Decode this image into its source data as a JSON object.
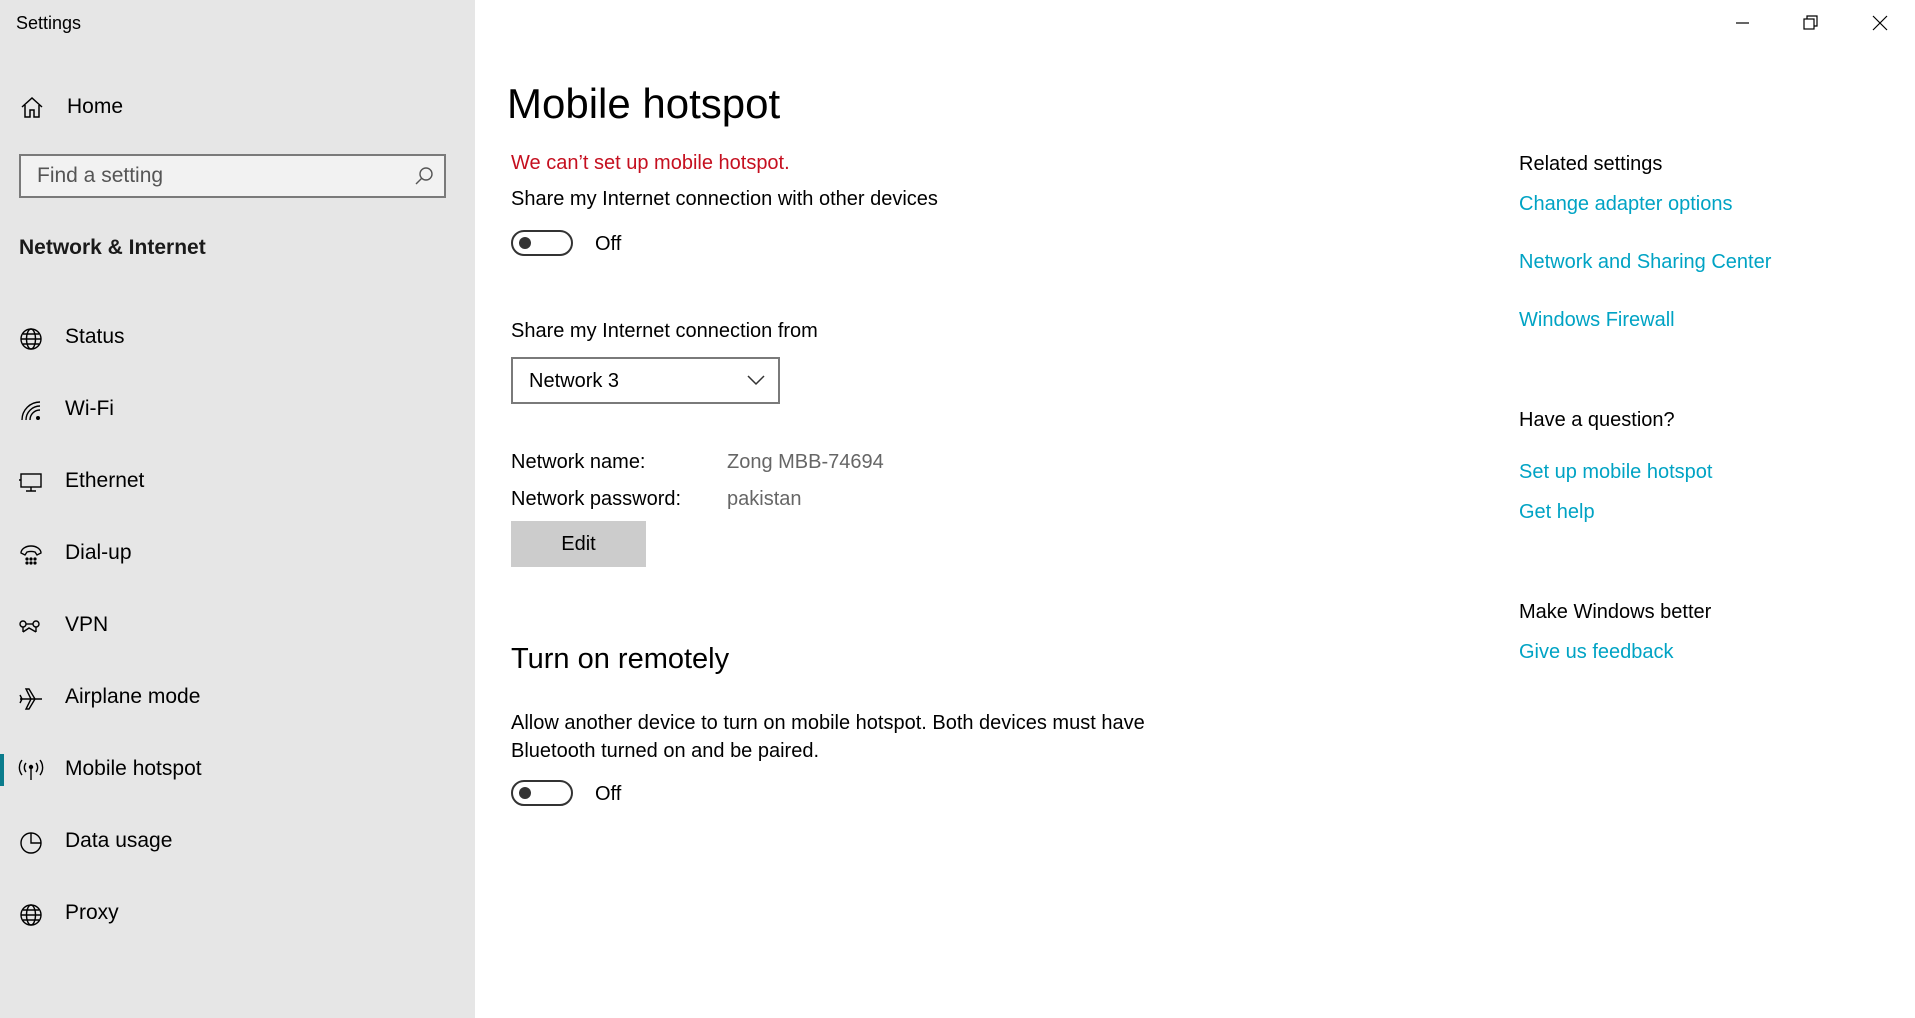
{
  "window": {
    "title": "Settings",
    "controls": {
      "minimize": "minimize-icon",
      "restore": "restore-icon",
      "close": "close-icon"
    }
  },
  "sidebar": {
    "home_label": "Home",
    "search_placeholder": "Find a setting",
    "section_title": "Network & Internet",
    "items": [
      {
        "label": "Status",
        "icon": "globe-status-icon"
      },
      {
        "label": "Wi-Fi",
        "icon": "wifi-icon"
      },
      {
        "label": "Ethernet",
        "icon": "ethernet-icon"
      },
      {
        "label": "Dial-up",
        "icon": "dialup-icon"
      },
      {
        "label": "VPN",
        "icon": "vpn-icon"
      },
      {
        "label": "Airplane mode",
        "icon": "airplane-icon"
      },
      {
        "label": "Mobile hotspot",
        "icon": "hotspot-icon",
        "active": true
      },
      {
        "label": "Data usage",
        "icon": "data-usage-icon"
      },
      {
        "label": "Proxy",
        "icon": "proxy-globe-icon"
      }
    ]
  },
  "main": {
    "title": "Mobile hotspot",
    "error": "We can’t set up mobile hotspot.",
    "share_label": "Share my Internet connection with other devices",
    "share_toggle_state": "Off",
    "share_from_label": "Share my Internet connection from",
    "share_from_value": "Network 3",
    "network_name_label": "Network name:",
    "network_name_value": "Zong MBB-74694",
    "network_password_label": "Network password:",
    "network_password_value": "pakistan",
    "edit_label": "Edit",
    "remote_heading": "Turn on remotely",
    "remote_desc": "Allow another device to turn on mobile hotspot. Both devices must have Bluetooth turned on and be paired.",
    "remote_toggle_state": "Off"
  },
  "related": {
    "heading": "Related settings",
    "links": [
      "Change adapter options",
      "Network and Sharing Center",
      "Windows Firewall"
    ],
    "question_heading": "Have a question?",
    "question_links": [
      "Set up mobile hotspot",
      "Get help"
    ],
    "better_heading": "Make Windows better",
    "better_links": [
      "Give us feedback"
    ]
  },
  "colors": {
    "sidebar_bg": "#e6e6e6",
    "error": "#c50f1f",
    "link": "#00a3c4",
    "accent": "#0a7c8c"
  }
}
